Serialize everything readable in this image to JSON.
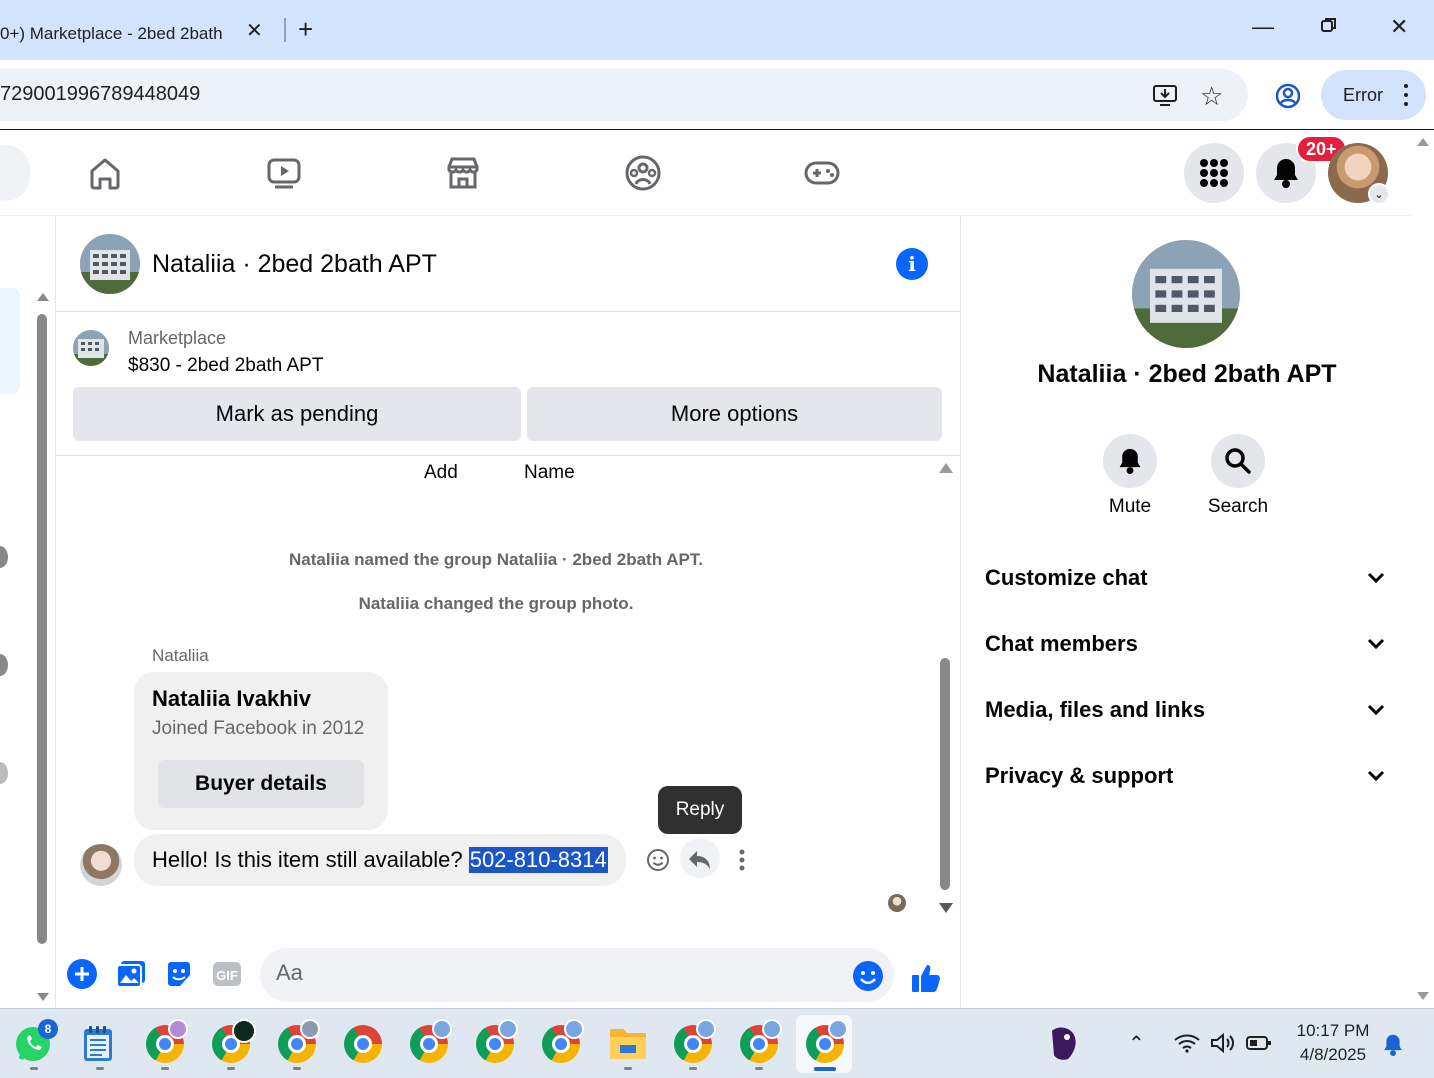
{
  "browser": {
    "tab_title": "0+) Marketplace - 2bed 2bath",
    "url_fragment": "729001996789448049",
    "error_label": "Error"
  },
  "fbnav": {
    "notification_badge": "20+"
  },
  "chat": {
    "title": "Nataliia · 2bed 2bath APT",
    "marketplace_label": "Marketplace",
    "listing": "$830 - 2bed 2bath APT",
    "mark_pending": "Mark as pending",
    "more_options": "More options",
    "ghost_add": "Add",
    "ghost_name": "Name",
    "system_messages": [
      "Nataliia named the group Nataliia · 2bed 2bath APT.",
      "Nataliia changed the group photo."
    ],
    "sender": "Nataliia",
    "buyer_card": {
      "name": "Nataliia Ivakhiv",
      "joined": "Joined Facebook in 2012",
      "button": "Buyer details"
    },
    "message": {
      "text": "Hello! Is this item still available? ",
      "highlighted": "502-810-8314"
    },
    "tooltip": "Reply",
    "composer_placeholder": "Aa"
  },
  "right_panel": {
    "name": "Nataliia · 2bed 2bath APT",
    "mute_label": "Mute",
    "search_label": "Search",
    "sections": [
      "Customize chat",
      "Chat members",
      "Media, files and links",
      "Privacy & support"
    ]
  },
  "taskbar": {
    "whatsapp_badge": "8",
    "time": "10:17 PM",
    "date": "4/8/2025"
  },
  "colors": {
    "accent": "#0866ff",
    "badge": "#e41e3f",
    "selection": "#1a56c4",
    "bubble": "#f0f0f0"
  }
}
